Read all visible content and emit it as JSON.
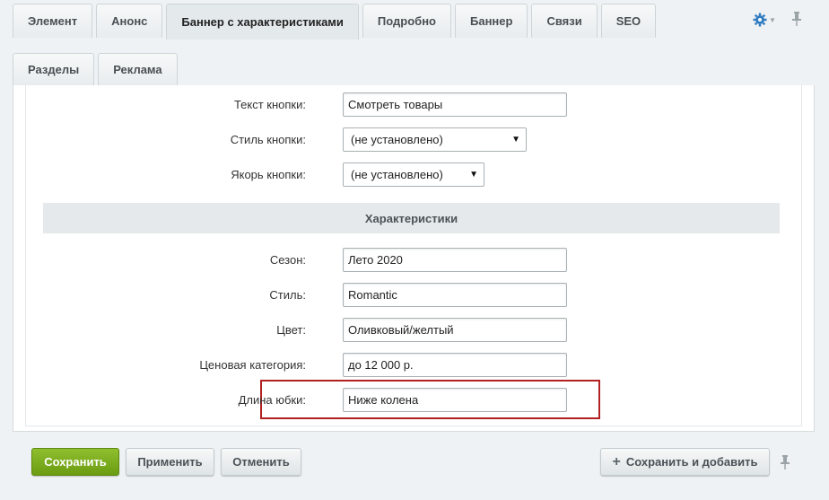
{
  "tabs_row1": [
    {
      "label": "Элемент"
    },
    {
      "label": "Анонс"
    },
    {
      "label": "Баннер с характеристиками",
      "active": true
    },
    {
      "label": "Подробно"
    },
    {
      "label": "Баннер"
    },
    {
      "label": "Связи"
    },
    {
      "label": "SEO"
    }
  ],
  "tabs_row2": [
    {
      "label": "Разделы"
    },
    {
      "label": "Реклама"
    }
  ],
  "form": {
    "button_text": {
      "label": "Текст кнопки:",
      "value": "Смотреть товары"
    },
    "button_style": {
      "label": "Стиль кнопки:",
      "value": "(не установлено)"
    },
    "button_anchor": {
      "label": "Якорь кнопки:",
      "value": "(не установлено)"
    },
    "section_title": "Характеристики",
    "season": {
      "label": "Сезон:",
      "value": "Лето 2020"
    },
    "style": {
      "label": "Стиль:",
      "value": "Romantic"
    },
    "color": {
      "label": "Цвет:",
      "value": "Оливковый/желтый"
    },
    "price_category": {
      "label": "Ценовая категория:",
      "value": "до 12 000 р."
    },
    "skirt_length": {
      "label": "Длина юбки:",
      "value": "Ниже колена"
    }
  },
  "footer": {
    "save": "Сохранить",
    "apply": "Применить",
    "cancel": "Отменить",
    "save_and_add": "Сохранить и добавить"
  },
  "colors": {
    "accent_gear": "#2f7bbf",
    "save_green": "#7aab1e",
    "highlight_red": "#b22121"
  },
  "icons": {
    "settings": "gear-icon",
    "pin": "pin-icon",
    "plus": "plus-icon"
  }
}
